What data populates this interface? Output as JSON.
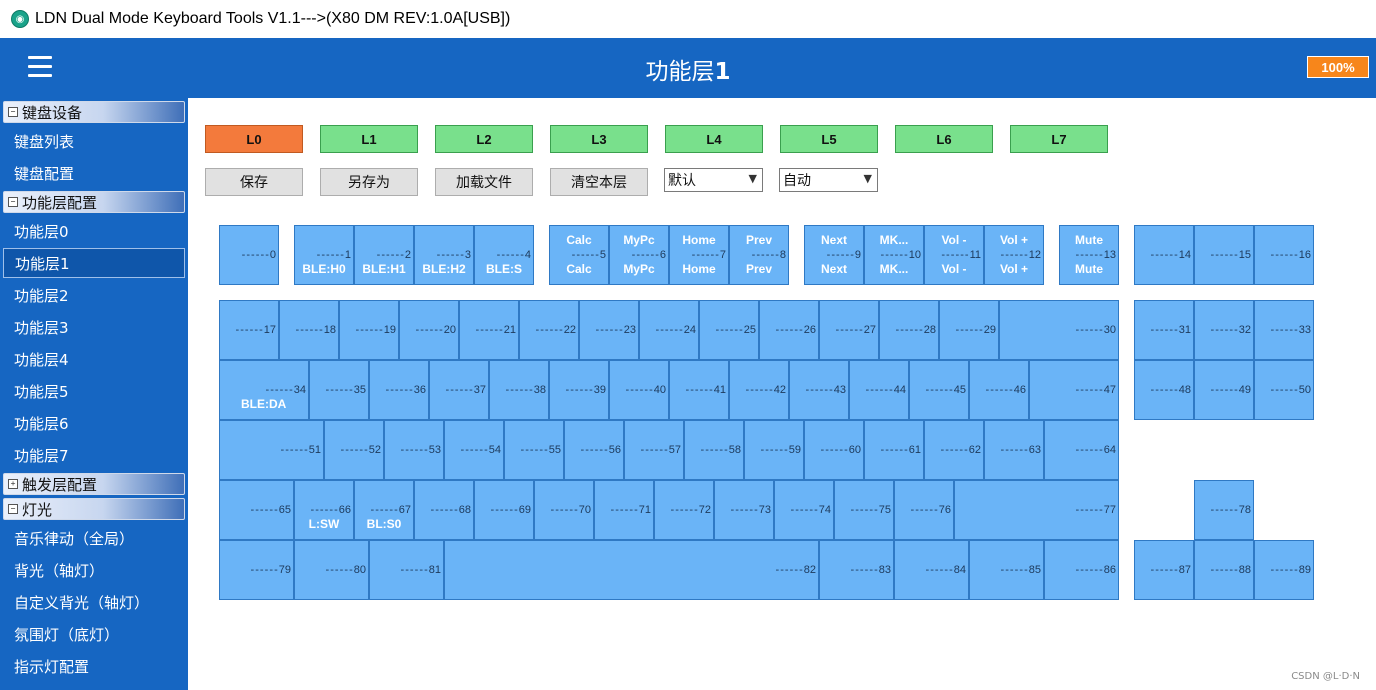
{
  "window": {
    "title": "LDN Dual Mode Keyboard Tools V1.1--->(X80 DM REV:1.0A[USB])"
  },
  "header": {
    "title_prefix": "功能层",
    "title_num": "1",
    "battery": "100%"
  },
  "sidebar": {
    "groups": [
      {
        "label": "键盘设备",
        "expand": "−"
      },
      {
        "label": "功能层配置",
        "expand": "−"
      },
      {
        "label": "触发层配置",
        "expand": "+"
      },
      {
        "label": "灯光",
        "expand": "−"
      }
    ],
    "items": [
      "键盘列表",
      "键盘配置",
      "功能层0",
      "功能层1",
      "功能层2",
      "功能层3",
      "功能层4",
      "功能层5",
      "功能层6",
      "功能层7",
      "音乐律动（全局）",
      "背光（轴灯）",
      "自定义背光（轴灯）",
      "氛围灯（底灯）",
      "指示灯配置"
    ]
  },
  "layers": [
    "L0",
    "L1",
    "L2",
    "L3",
    "L4",
    "L5",
    "L6",
    "L7"
  ],
  "actions": {
    "save": "保存",
    "save_as": "另存为",
    "load": "加载文件",
    "clear": "清空本层"
  },
  "selects": {
    "mode": "默认",
    "auto": "自动"
  },
  "icons": {
    "app": "ldn-app-icon",
    "chevron": "chevron-down-icon",
    "menu": "hamburger-menu-icon"
  },
  "keys": {
    "k0": {
      "num": "0"
    },
    "k1": {
      "num": "1",
      "bot": "BLE:H0"
    },
    "k2": {
      "num": "2",
      "bot": "BLE:H1"
    },
    "k3": {
      "num": "3",
      "bot": "BLE:H2"
    },
    "k4": {
      "num": "4",
      "bot": "BLE:S"
    },
    "k5": {
      "num": "5",
      "top": "Calc",
      "bot": "Calc"
    },
    "k6": {
      "num": "6",
      "top": "MyPc",
      "bot": "MyPc"
    },
    "k7": {
      "num": "7",
      "top": "Home",
      "bot": "Home"
    },
    "k8": {
      "num": "8",
      "top": "Prev",
      "bot": "Prev"
    },
    "k9": {
      "num": "9",
      "top": "Next",
      "bot": "Next"
    },
    "k10": {
      "num": "10",
      "top": "MK...",
      "bot": "MK..."
    },
    "k11": {
      "num": "11",
      "top": "Vol -",
      "bot": "Vol -"
    },
    "k12": {
      "num": "12",
      "top": "Vol +",
      "bot": "Vol +"
    },
    "k13": {
      "num": "13",
      "top": "Mute",
      "bot": "Mute"
    },
    "k14": {
      "num": "14"
    },
    "k15": {
      "num": "15"
    },
    "k16": {
      "num": "16"
    },
    "k17": {
      "num": "17"
    },
    "k18": {
      "num": "18"
    },
    "k19": {
      "num": "19"
    },
    "k20": {
      "num": "20"
    },
    "k21": {
      "num": "21"
    },
    "k22": {
      "num": "22"
    },
    "k23": {
      "num": "23"
    },
    "k24": {
      "num": "24"
    },
    "k25": {
      "num": "25"
    },
    "k26": {
      "num": "26"
    },
    "k27": {
      "num": "27"
    },
    "k28": {
      "num": "28"
    },
    "k29": {
      "num": "29"
    },
    "k30": {
      "num": "30"
    },
    "k31": {
      "num": "31"
    },
    "k32": {
      "num": "32"
    },
    "k33": {
      "num": "33"
    },
    "k34": {
      "num": "34",
      "bot": "BLE:DA"
    },
    "k35": {
      "num": "35"
    },
    "k36": {
      "num": "36"
    },
    "k37": {
      "num": "37"
    },
    "k38": {
      "num": "38"
    },
    "k39": {
      "num": "39"
    },
    "k40": {
      "num": "40"
    },
    "k41": {
      "num": "41"
    },
    "k42": {
      "num": "42"
    },
    "k43": {
      "num": "43"
    },
    "k44": {
      "num": "44"
    },
    "k45": {
      "num": "45"
    },
    "k46": {
      "num": "46"
    },
    "k47": {
      "num": "47"
    },
    "k48": {
      "num": "48"
    },
    "k49": {
      "num": "49"
    },
    "k50": {
      "num": "50"
    },
    "k51": {
      "num": "51"
    },
    "k52": {
      "num": "52"
    },
    "k53": {
      "num": "53"
    },
    "k54": {
      "num": "54"
    },
    "k55": {
      "num": "55"
    },
    "k56": {
      "num": "56"
    },
    "k57": {
      "num": "57"
    },
    "k58": {
      "num": "58"
    },
    "k59": {
      "num": "59"
    },
    "k60": {
      "num": "60"
    },
    "k61": {
      "num": "61"
    },
    "k62": {
      "num": "62"
    },
    "k63": {
      "num": "63"
    },
    "k64": {
      "num": "64"
    },
    "k65": {
      "num": "65"
    },
    "k66": {
      "num": "66",
      "bot": "L:SW"
    },
    "k67": {
      "num": "67",
      "bot": "BL:S0"
    },
    "k68": {
      "num": "68"
    },
    "k69": {
      "num": "69"
    },
    "k70": {
      "num": "70"
    },
    "k71": {
      "num": "71"
    },
    "k72": {
      "num": "72"
    },
    "k73": {
      "num": "73"
    },
    "k74": {
      "num": "74"
    },
    "k75": {
      "num": "75"
    },
    "k76": {
      "num": "76"
    },
    "k77": {
      "num": "77"
    },
    "k78": {
      "num": "78"
    },
    "k79": {
      "num": "79"
    },
    "k80": {
      "num": "80"
    },
    "k81": {
      "num": "81"
    },
    "k82": {
      "num": "82"
    },
    "k83": {
      "num": "83"
    },
    "k84": {
      "num": "84"
    },
    "k85": {
      "num": "85"
    },
    "k86": {
      "num": "86"
    },
    "k87": {
      "num": "87"
    },
    "k88": {
      "num": "88"
    },
    "k89": {
      "num": "89"
    }
  },
  "watermark": "CSDN @L·D·N",
  "colors": {
    "header": "#1666c2",
    "key": "#6ab4f7",
    "layer": "#79e08c",
    "layer_active": "#f37a3c",
    "battery": "#f7861b"
  }
}
